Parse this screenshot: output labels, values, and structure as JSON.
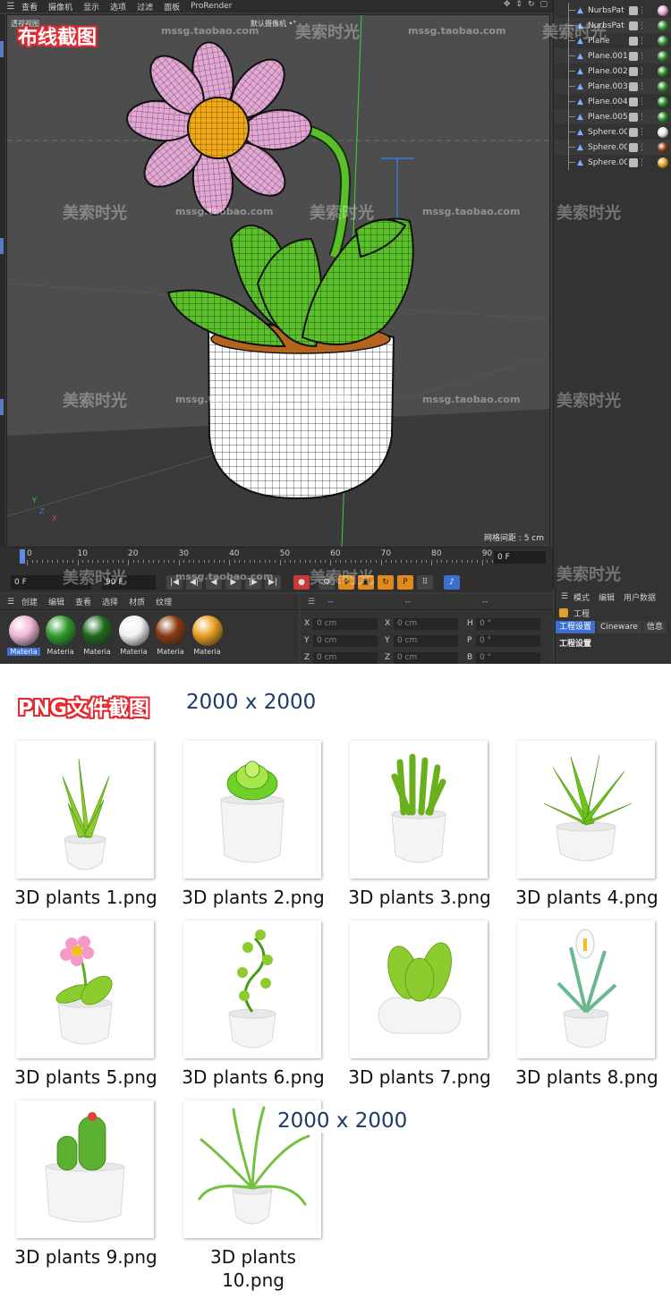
{
  "menubar": {
    "items": [
      "查看",
      "摄像机",
      "显示",
      "选项",
      "过滤",
      "面板",
      "ProRender"
    ]
  },
  "viewport": {
    "title": "透视视图",
    "camera": "默认摄像机 •°",
    "grid_spacing": "网格间距 : 5 cm",
    "axis_y": "Y",
    "axis_x": "X",
    "axis_z": "Z"
  },
  "top_label": "布线截图",
  "watermarks": {
    "cn": "美索时光",
    "url": "mssg.taobao.com"
  },
  "objects": [
    {
      "name": "NurbsPat",
      "mat": "#e8a8d0"
    },
    {
      "name": "NurbsPat",
      "mat": "#2e8f2e"
    },
    {
      "name": "Plane",
      "mat": "#2e8f2e"
    },
    {
      "name": "Plane.001",
      "mat": "#2e8f2e"
    },
    {
      "name": "Plane.002",
      "mat": "#2e8f2e"
    },
    {
      "name": "Plane.003",
      "mat": "#2e8f2e"
    },
    {
      "name": "Plane.004",
      "mat": "#2e8f2e"
    },
    {
      "name": "Plane.005",
      "mat": "#2e8f2e"
    },
    {
      "name": "Sphere.00",
      "mat": "#e8e8e8"
    },
    {
      "name": "Sphere.00",
      "mat": "#8a3a10"
    },
    {
      "name": "Sphere.00",
      "mat": "#e0a020"
    }
  ],
  "timeline": {
    "ticks": [
      "0",
      "10",
      "20",
      "30",
      "40",
      "50",
      "60",
      "70",
      "80",
      "90"
    ],
    "frame_end_field": "0 F",
    "current": "0 F",
    "end": "90 F"
  },
  "material_manager": {
    "menu": [
      "创建",
      "编辑",
      "查看",
      "选择",
      "材质",
      "纹理"
    ],
    "materials": [
      {
        "name": "Materia",
        "color": "#f0b6d6"
      },
      {
        "name": "Materia",
        "color": "#2e9a2e"
      },
      {
        "name": "Materia",
        "color": "#1f6a1f"
      },
      {
        "name": "Materia",
        "color": "#f2f2f2"
      },
      {
        "name": "Materia",
        "color": "#8a3a10"
      },
      {
        "name": "Materia",
        "color": "#e8a020"
      }
    ]
  },
  "coords": {
    "header_left": "--",
    "header_mid": "--",
    "header_right": "--",
    "rows": [
      {
        "a": "X",
        "av": "0 cm",
        "b": "X",
        "bv": "0 cm",
        "c": "H",
        "cv": "0 °"
      },
      {
        "a": "Y",
        "av": "0 cm",
        "b": "Y",
        "bv": "0 cm",
        "c": "P",
        "cv": "0 °"
      },
      {
        "a": "Z",
        "av": "0 cm",
        "b": "Z",
        "bv": "0 cm",
        "c": "B",
        "cv": "0 °"
      }
    ]
  },
  "attributes": {
    "menu": [
      "模式",
      "编辑",
      "用户数据"
    ],
    "title": "工程",
    "tabs": [
      "工程设置",
      "Cineware",
      "信息"
    ],
    "section": "工程设置"
  },
  "png_section": {
    "heading": "PNG文件截图",
    "size": "2000 x 2000",
    "float_size": "2000 x 2000",
    "files": [
      "3D plants 1.png",
      "3D plants 2.png",
      "3D plants 3.png",
      "3D plants 4.png",
      "3D plants 5.png",
      "3D plants 6.png",
      "3D plants 7.png",
      "3D plants 8.png",
      "3D plants 9.png",
      "3D plants 10.png"
    ]
  },
  "colors": {
    "accent_red": "#e5282e",
    "select_blue": "#3d6fd1",
    "size_text": "#1c3a66"
  }
}
